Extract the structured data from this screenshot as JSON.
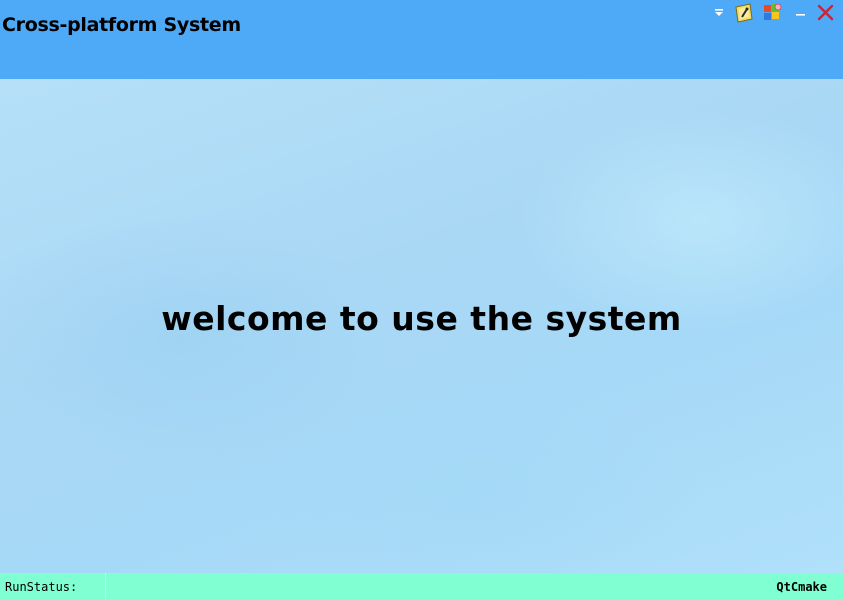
{
  "window": {
    "title": "Cross-platform System"
  },
  "title_bar_buttons": [
    {
      "name": "menu-dropdown-icon"
    },
    {
      "name": "skin-icon"
    },
    {
      "name": "app-logo-icon"
    },
    {
      "name": "minimize-icon"
    },
    {
      "name": "close-icon"
    }
  ],
  "main": {
    "welcome_text": "welcome to use the system"
  },
  "status_bar": {
    "run_status_label": "RunStatus:",
    "right_label": "QtCmake"
  },
  "colors": {
    "title_bar": "#4ea9f7",
    "main_background": "#aadcf8",
    "status_bar": "#7fffd2",
    "close_icon": "#c0283e"
  }
}
